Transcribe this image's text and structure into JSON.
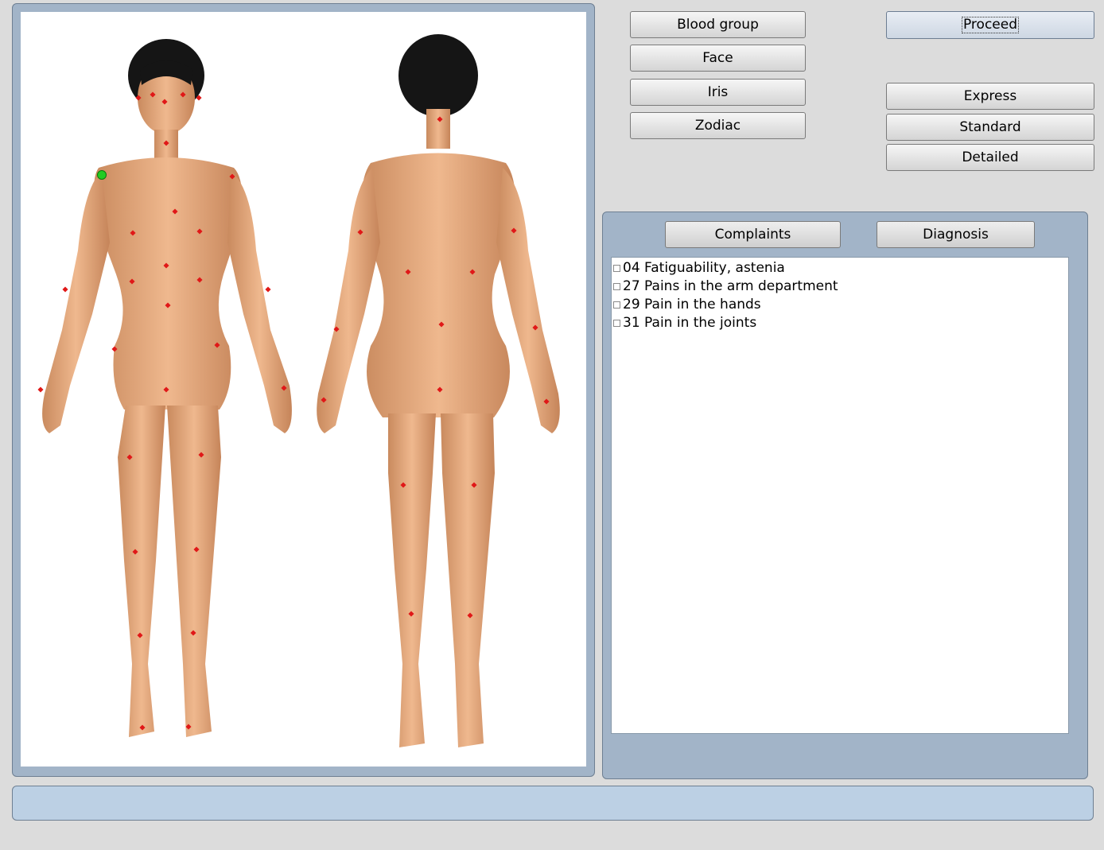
{
  "left_buttons": {
    "blood_group": "Blood group",
    "face": "Face",
    "iris": "Iris",
    "zodiac": "Zodiac"
  },
  "right_buttons": {
    "proceed": "Proceed",
    "express": "Express",
    "standard": "Standard",
    "detailed": "Detailed"
  },
  "tabs": {
    "complaints": "Complaints",
    "diagnosis": "Diagnosis"
  },
  "complaints": [
    {
      "label": "04 Fatiguability, astenia",
      "checked": false
    },
    {
      "label": "27 Pains in the arm department",
      "checked": false
    },
    {
      "label": "29 Pain in the hands",
      "checked": false
    },
    {
      "label": "31 Pain in the joints",
      "checked": false
    }
  ],
  "colors": {
    "panel": "#a2b4c8",
    "status_bar": "#bcd0e4",
    "point": "#e01818",
    "selected_point": "#22cc22",
    "skin": "#e0a57a",
    "hair": "#151515"
  }
}
